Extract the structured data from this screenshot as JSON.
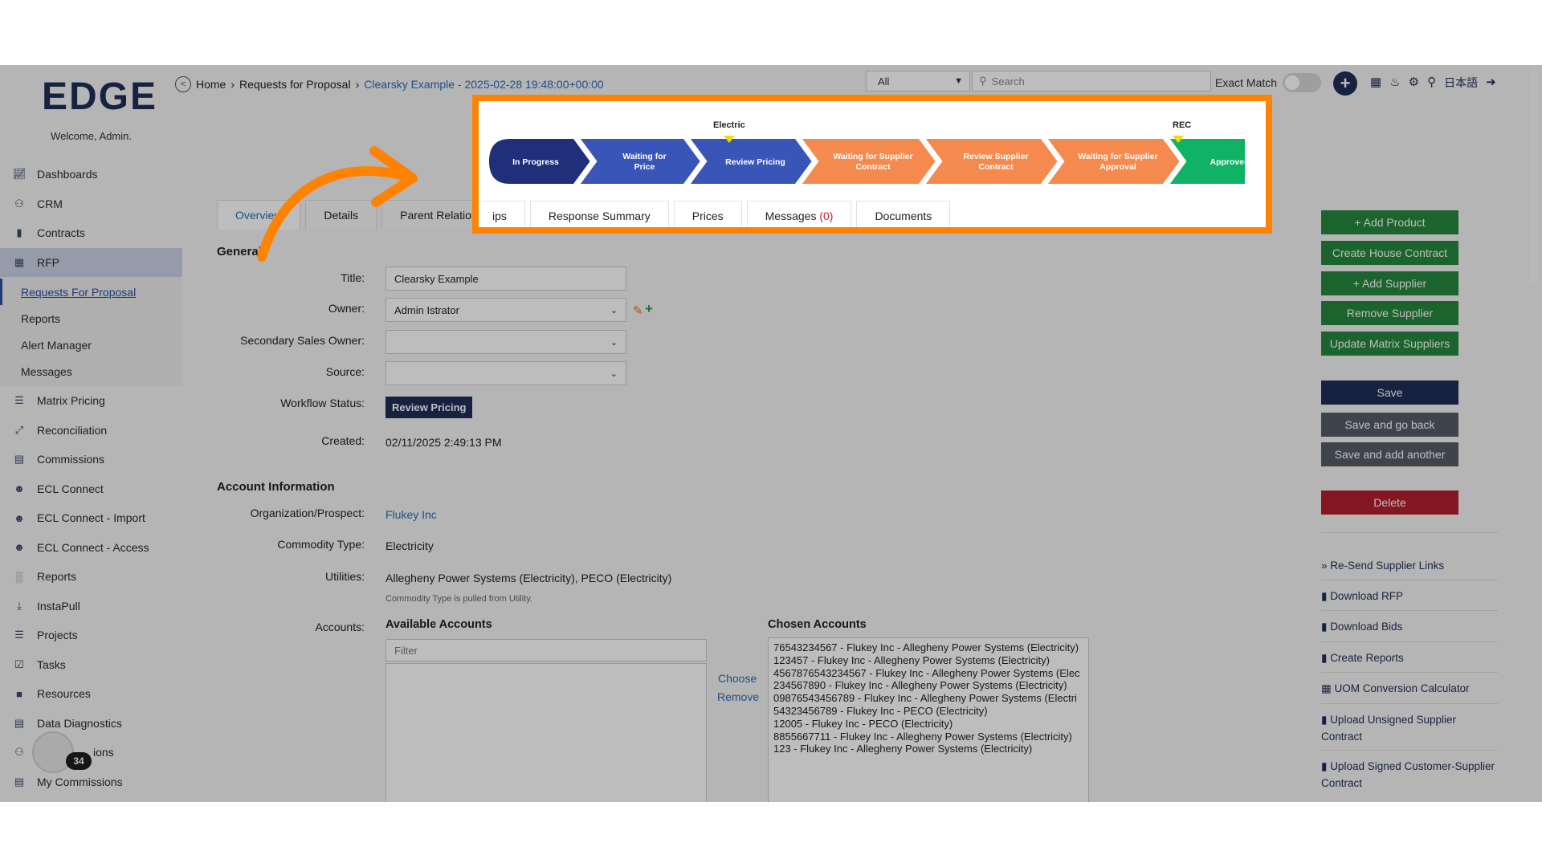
{
  "app": {
    "logo": "EDGE",
    "welcome": "Welcome, Admin."
  },
  "breadcrumb": {
    "home": "Home",
    "sep": "›",
    "section": "Requests for Proposal",
    "current": "Clearsky Example - 2025-02-28 19:48:00+00:00"
  },
  "search": {
    "scope": "All",
    "placeholder": "Search",
    "exact_label": "Exact Match"
  },
  "sidebar": {
    "items": [
      {
        "label": "Dashboards",
        "icon": "chart-icon"
      },
      {
        "label": "CRM",
        "icon": "users-icon"
      },
      {
        "label": "Contracts",
        "icon": "file-icon"
      },
      {
        "label": "RFP",
        "icon": "sitemap-icon"
      }
    ],
    "rfp_sub": [
      "Requests For Proposal",
      "Reports",
      "Alert Manager",
      "Messages"
    ],
    "items2": [
      {
        "label": "Matrix Pricing",
        "icon": "list-icon"
      },
      {
        "label": "Reconciliation",
        "icon": "compress-icon"
      },
      {
        "label": "Commissions",
        "icon": "money-icon"
      },
      {
        "label": "ECL Connect",
        "icon": "user-search-icon"
      },
      {
        "label": "ECL Connect - Import",
        "icon": "user-search-icon"
      },
      {
        "label": "ECL Connect - Access",
        "icon": "user-search-icon"
      },
      {
        "label": "Reports",
        "icon": "bar-chart-icon"
      },
      {
        "label": "InstaPull",
        "icon": "download-icon"
      },
      {
        "label": "Projects",
        "icon": "tasks-icon"
      },
      {
        "label": "Tasks",
        "icon": "calendar-check-icon"
      },
      {
        "label": "Resources",
        "icon": "folder-icon"
      },
      {
        "label": "Data Diagnostics",
        "icon": "server-icon"
      },
      {
        "label": "ions",
        "icon": "users-icon"
      },
      {
        "label": "My Commissions",
        "icon": "money-icon"
      }
    ],
    "badge": "34"
  },
  "workflow": {
    "stages": [
      "In Progress",
      "Waiting for Price",
      "Review Pricing",
      "Waiting for Supplier Contract",
      "Review Supplier Contract",
      "Waiting for Supplier Approval",
      "Approved"
    ],
    "label_electric": "Electric",
    "label_rec": "REC",
    "colors": {
      "in_progress": "#1f2f7a",
      "blue": "#3a55b8",
      "orange": "#f58a4e",
      "green": "#10b365"
    }
  },
  "tabs": [
    "Overview",
    "Details",
    "Parent Relationships",
    "Response Summary",
    "Prices",
    "Messages",
    "Documents"
  ],
  "messages_count": "(0)",
  "general": {
    "title": "General",
    "title_label": "Title:",
    "title_value": "Clearsky Example",
    "owner_label": "Owner:",
    "owner_value": "Admin Istrator",
    "secondary_label": "Secondary Sales Owner:",
    "source_label": "Source:",
    "workflow_label": "Workflow Status:",
    "workflow_value": "Review Pricing",
    "created_label": "Created:",
    "created_value": "02/11/2025 2:49:13 PM"
  },
  "account": {
    "title": "Account Information",
    "org_label": "Organization/Prospect:",
    "org_value": "Flukey Inc",
    "commodity_label": "Commodity Type:",
    "commodity_value": "Electricity",
    "utilities_label": "Utilities:",
    "utilities_value": "Allegheny Power Systems (Electricity), PECO (Electricity)",
    "utilities_hint": "Commodity Type is pulled from Utility.",
    "accounts_label": "Accounts:",
    "available_title": "Available Accounts",
    "filter_placeholder": "Filter",
    "choose": "Choose",
    "remove": "Remove",
    "chosen_title": "Chosen Accounts",
    "chosen": [
      "76543234567 - Flukey Inc - Allegheny Power Systems (Electricity)",
      "123457 - Flukey Inc - Allegheny Power Systems (Electricity)",
      "4567876543234567 - Flukey Inc - Allegheny Power Systems (Elec",
      "234567890 - Flukey Inc - Allegheny Power Systems (Electricity)",
      "09876543456789 - Flukey Inc - Allegheny Power Systems (Electri",
      "54323456789 - Flukey Inc - PECO (Electricity)",
      "12005 - Flukey Inc - PECO (Electricity)",
      "8855667711 - Flukey Inc - Allegheny Power Systems (Electricity)",
      "123 - Flukey Inc - Allegheny Power Systems (Electricity)"
    ]
  },
  "actions": {
    "add_product": "+ Add Product",
    "create_house": "Create House Contract",
    "add_supplier": "+ Add Supplier",
    "remove_supplier": "Remove Supplier",
    "update_matrix": "Update Matrix Suppliers",
    "save": "Save",
    "save_back": "Save and go back",
    "save_another": "Save and add another",
    "delete": "Delete",
    "resend": "Re-Send Supplier Links",
    "download_rfp": "Download RFP",
    "download_bids": "Download Bids",
    "create_reports": "Create Reports",
    "uom": "UOM Conversion Calculator",
    "upload_unsigned": "Upload Unsigned Supplier Contract",
    "upload_signed": "Upload Signed Customer-Supplier Contract"
  },
  "header_icons": [
    "calendar-icon",
    "bell-icon",
    "gear-icon",
    "key-icon",
    "日本語",
    "sign-out-icon"
  ]
}
